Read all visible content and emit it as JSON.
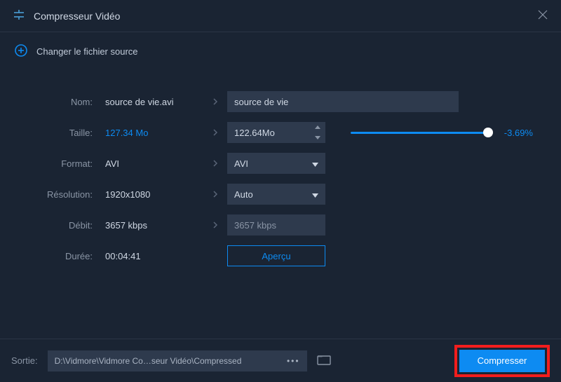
{
  "titlebar": {
    "title": "Compresseur Vidéo"
  },
  "source": {
    "label": "Changer le fichier source"
  },
  "fields": {
    "name": {
      "label": "Nom:",
      "value": "source de vie.avi",
      "input": "source de vie"
    },
    "size": {
      "label": "Taille:",
      "value": "127.34 Mo",
      "target": "122.64Mo",
      "percent": "-3.69%"
    },
    "format": {
      "label": "Format:",
      "value": "AVI",
      "selected": "AVI"
    },
    "resolution": {
      "label": "Résolution:",
      "value": "1920x1080",
      "selected": "Auto"
    },
    "bitrate": {
      "label": "Débit:",
      "value": "3657 kbps",
      "target": "3657 kbps"
    },
    "duration": {
      "label": "Durée:",
      "value": "00:04:41"
    }
  },
  "buttons": {
    "preview": "Aperçu",
    "compress": "Compresser"
  },
  "output": {
    "label": "Sortie:",
    "path": "D:\\Vidmore\\Vidmore Co…seur Vidéo\\Compressed"
  }
}
